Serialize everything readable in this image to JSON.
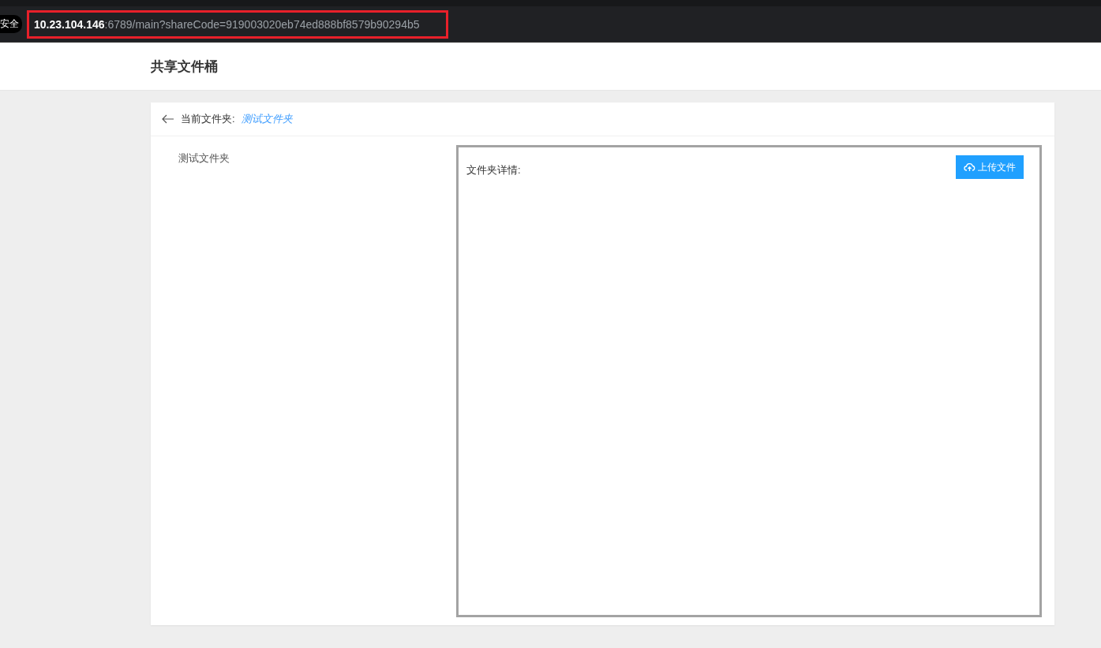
{
  "browser": {
    "security_badge": "安全",
    "url_host": "10.23.104.146",
    "url_rest": ":6789/main?shareCode=919003020eb74ed888bf8579b90294b5",
    "highlighted": true
  },
  "header": {
    "title": "共享文件桶"
  },
  "breadcrumb": {
    "label": "当前文件夹:",
    "folder": "测试文件夹"
  },
  "tree": {
    "items": [
      {
        "label": "测试文件夹"
      }
    ]
  },
  "details": {
    "label": "文件夹详情:",
    "upload_button": "上传文件"
  }
}
